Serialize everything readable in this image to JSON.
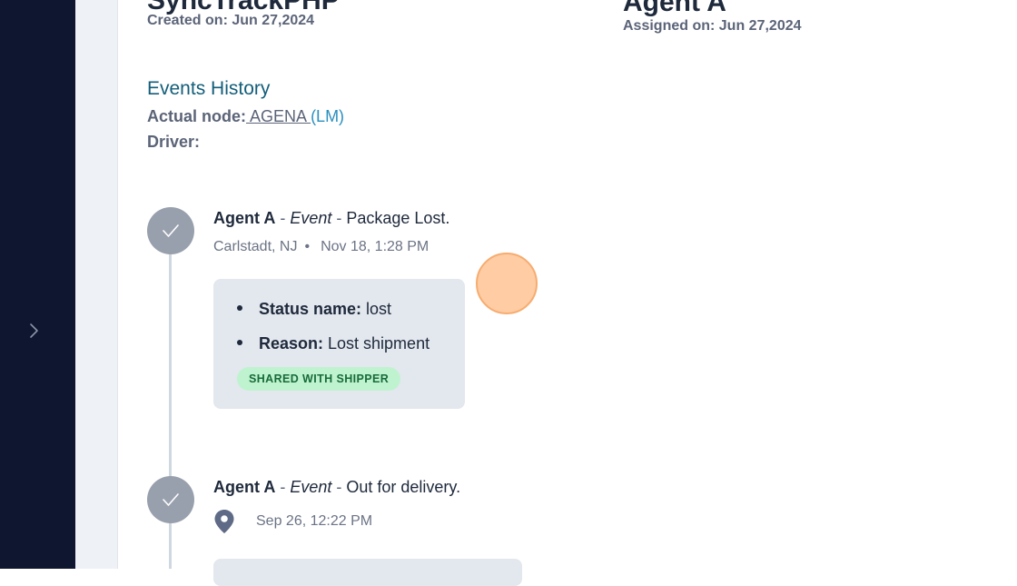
{
  "left_header": {
    "title": "SyncTrackPHP",
    "created_on": "Created on: Jun 27,2024"
  },
  "right_header": {
    "title": "Agent A",
    "assigned_on": "Assigned on: Jun 27,2024"
  },
  "events_history": {
    "heading": "Events History",
    "actual_node_label": "Actual node:",
    "actual_node_value": " AGENA ",
    "actual_node_suffix": "(LM)",
    "driver_label": "Driver:"
  },
  "events": [
    {
      "agent": "Agent A",
      "sep1": " - ",
      "type": "Event",
      "sep2": " - ",
      "description": "Package Lost.",
      "location": "Carlstadt, NJ",
      "dot": "•",
      "time": "Nov 18, 1:28 PM",
      "details": [
        {
          "label": "Status name:",
          "value": " lost"
        },
        {
          "label": "Reason:",
          "value": " Lost shipment"
        }
      ],
      "badge": "SHARED WITH SHIPPER"
    },
    {
      "agent": "Agent A",
      "sep1": " - ",
      "type": "Event",
      "sep2": " - ",
      "description": "Out for delivery.",
      "time": "Sep 26, 12:22 PM"
    }
  ],
  "icons": {
    "sidebar_toggle": "chevron-right-icon",
    "check": "check-icon",
    "location": "map-pin-icon"
  },
  "colors": {
    "sidebar": "#0e1630",
    "heading": "#135e7a",
    "node_link": "#2a8fbf",
    "check_circle": "#98a0ad",
    "badge_bg": "#bff3cf",
    "badge_text": "#176b3a"
  }
}
